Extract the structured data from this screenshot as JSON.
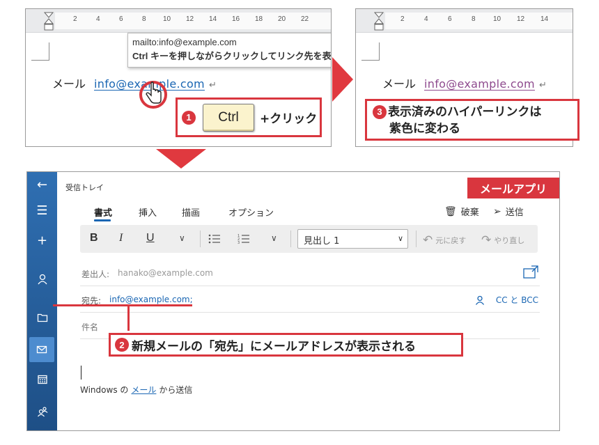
{
  "word_before": {
    "ruler_ticks": [
      "2",
      "4",
      "6",
      "8",
      "10",
      "12",
      "14",
      "16",
      "18",
      "20",
      "22"
    ],
    "label": "メール",
    "link_text": "info@example.com",
    "paragraph_mark": "↵",
    "tooltip_url": "mailto:info@example.com",
    "tooltip_hint": "Ctrl キーを押しながらクリックしてリンク先を表示"
  },
  "word_after": {
    "ruler_ticks": [
      "2",
      "4",
      "6",
      "8",
      "10",
      "12",
      "14"
    ],
    "label": "メール",
    "link_text": "info@example.com",
    "paragraph_mark": "↵"
  },
  "callout1": {
    "number": "1",
    "key": "Ctrl",
    "text": "+クリック"
  },
  "callout2": {
    "number": "2",
    "text": "新規メールの「宛先」にメールアドレスが表示される"
  },
  "callout3": {
    "number": "3",
    "line1": "表示済みのハイパーリンクは",
    "line2": "紫色に変わる"
  },
  "mail": {
    "app_label": "メールアプリ",
    "inbox": "受信トレイ",
    "tabs": [
      "書式",
      "挿入",
      "描画",
      "オプション"
    ],
    "discard": "破棄",
    "send": "送信",
    "toolbar": {
      "bold": "B",
      "italic": "I",
      "underline": "U",
      "heading": "見出し 1",
      "undo": "元に戻す",
      "redo": "やり直し"
    },
    "from_label": "差出人:",
    "from_value": "hanako@example.com",
    "to_label": "宛先:",
    "to_value": "info@example.com;",
    "cc_bcc": "CC と BCC",
    "subject_label": "件名",
    "signature_pre": "Windows の",
    "signature_link": "メール",
    "signature_post": "から送信"
  },
  "colors": {
    "accent_red": "#d9363e",
    "link_blue": "#1a66b3",
    "visited_purple": "#8e4a8e",
    "sidebar_blue": "#2f6fb2",
    "key_yellow": "#fbf3cd"
  }
}
